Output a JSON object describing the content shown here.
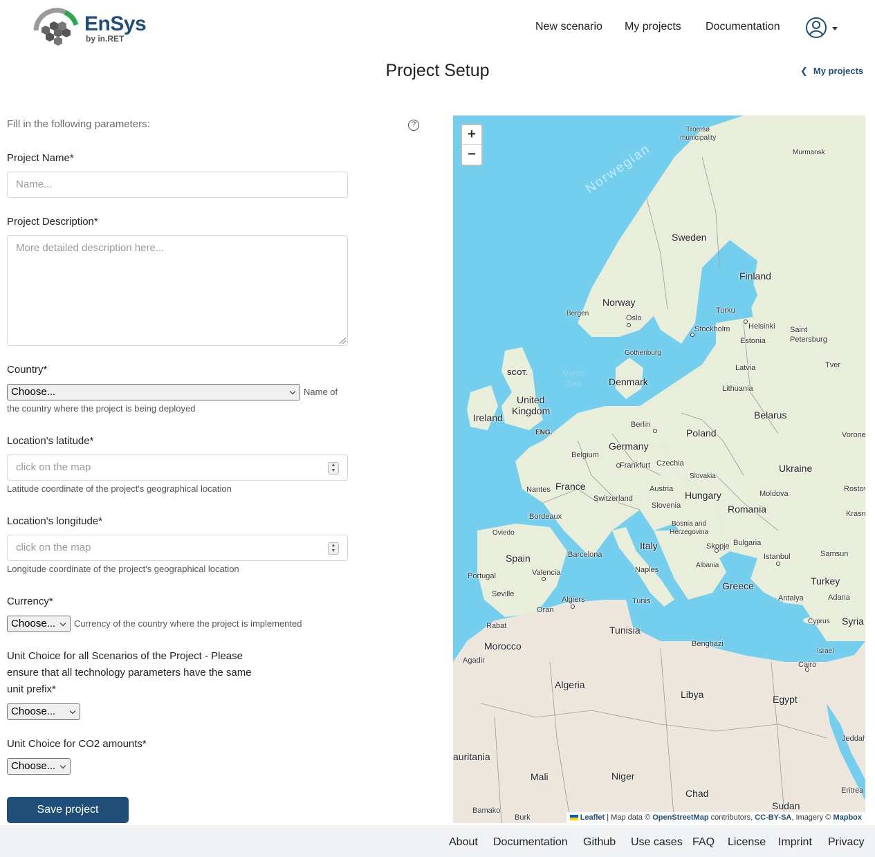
{
  "header": {
    "logo_text": "EnSys",
    "logo_sub": "by in.RET",
    "nav": [
      "New scenario",
      "My projects",
      "Documentation"
    ]
  },
  "page": {
    "title": "Project Setup",
    "back_link": "My projects"
  },
  "form": {
    "intro": "Fill in the following parameters:",
    "help_icon": "?",
    "project_name": {
      "label": "Project Name*",
      "placeholder": "Name..."
    },
    "project_description": {
      "label": "Project Description*",
      "placeholder": "More detailed description here..."
    },
    "country": {
      "label": "Country*",
      "value": "Choose...",
      "help_a": "Name of",
      "help_b": "the country where the project is being deployed"
    },
    "latitude": {
      "label": "Location's latitude*",
      "placeholder": "click on the map",
      "help": "Latitude coordinate of the project's geographical location"
    },
    "longitude": {
      "label": "Location's longitude*",
      "placeholder": "click on the map",
      "help": "Longitude coordinate of the project's geographical location"
    },
    "currency": {
      "label": "Currency*",
      "value": "Choose...",
      "help": "Currency of the country where the project is implemented"
    },
    "unit_choice": {
      "label_1": "Unit Choice for all Scenarios of the Project - Please",
      "label_2": "ensure that all technology parameters have the same",
      "label_3": "unit prefix*",
      "value": "Choose..."
    },
    "co2_unit": {
      "label": "Unit Choice for CO2 amounts*",
      "value": "Choose..."
    },
    "save_button": "Save project"
  },
  "map": {
    "zoom_in": "+",
    "zoom_out": "−",
    "ocean_label": "Norwegian",
    "sea_label_1": "North",
    "sea_label_2": "Sea",
    "countries": [
      "Sweden",
      "Finland",
      "Norway",
      "Estonia",
      "Latvia",
      "Lithuania",
      "Denmark",
      "United",
      "Kingdom",
      "Ireland",
      "Belarus",
      "Poland",
      "Germany",
      "Belgium",
      "Czechia",
      "Slovakia",
      "Ukraine",
      "France",
      "Switzerland",
      "Austria",
      "Hungary",
      "Moldova",
      "Slovenia",
      "Romania",
      "Bosnia and",
      "Herzegovina",
      "Italy",
      "Spain",
      "Portugal",
      "Bulgaria",
      "Albania",
      "Greece",
      "Turkey",
      "Syria",
      "Tunisia",
      "Morocco",
      "Algeria",
      "Libya",
      "Egypt",
      "Mali",
      "Niger",
      "Chad",
      "Sudan",
      "auritania",
      "SCOT.",
      "ENG.",
      "Israel",
      "Cyprus",
      "Eritrea"
    ],
    "cities": [
      "Tromsø",
      "municipality",
      "Murmansk",
      "Bergen",
      "Oslo",
      "Stockholm",
      "Turku",
      "Helsinki",
      "Saint",
      "Petersburg",
      "Gothenburg",
      "Tver",
      "Berlin",
      "Frankfurt",
      "Vorone",
      "Nantes",
      "Bordeaux",
      "Rostov-o",
      "Krasnod",
      "Oviedo",
      "Barcelona",
      "Skopje",
      "Istanbul",
      "Samsun",
      "Valencia",
      "Naples",
      "Seville",
      "Algiers",
      "Tunis",
      "Antalya",
      "Adana",
      "Oran",
      "Rabat",
      "Agadir",
      "Benghazi",
      "Cairo",
      "Jeddah",
      "Bamako",
      "Burk"
    ],
    "attribution": {
      "leaflet": "Leaflet",
      "middle": " | Map data © ",
      "osm": "OpenStreetMap",
      "contrib": " contributors, ",
      "license": "CC-BY-SA",
      "imagery": ", Imagery © ",
      "mapbox": "Mapbox"
    }
  },
  "footer": {
    "links": [
      "About",
      "Documentation",
      "Github",
      "Use cases",
      "FAQ",
      "License",
      "Imprint",
      "Privacy"
    ]
  },
  "colors": {
    "brand": "#1f4e79",
    "sea": "#74cfee",
    "land_north": "#e8eed9",
    "land_south": "#ece6dc"
  }
}
